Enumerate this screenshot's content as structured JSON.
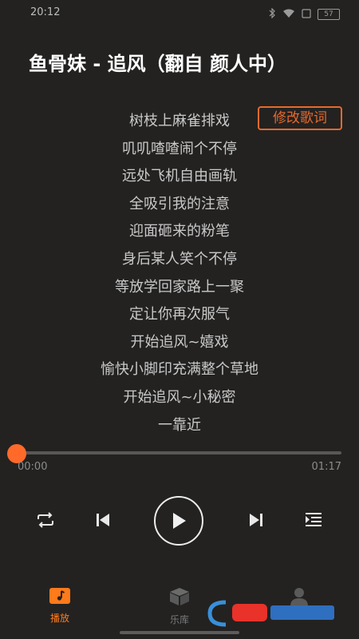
{
  "status_bar": {
    "time": "20:12",
    "battery": "57"
  },
  "song_title": "鱼骨妹 - 追风（翻自 颜人中）",
  "edit_lyrics_label": "修改歌词",
  "lyrics": [
    "树枝上麻雀排戏",
    "叽叽喳喳闹个不停",
    "远处飞机自由画轨",
    "全吸引我的注意",
    "迎面砸来的粉笔",
    "身后某人笑个不停",
    "等放学回家路上一聚",
    "定让你再次服气",
    "开始追风~嬉戏",
    "愉快小脚印充满整个草地",
    "开始追风~小秘密",
    "一靠近"
  ],
  "player": {
    "current_time": "00:00",
    "total_time": "01:17",
    "progress_fraction": 0.0
  },
  "controls": [
    "repeat-icon",
    "previous-icon",
    "play-icon",
    "next-icon",
    "playlist-icon"
  ],
  "nav": {
    "play_label": "播放",
    "library_label": "乐库"
  },
  "colors": {
    "accent": "#ff6a2a",
    "background": "#232221"
  }
}
